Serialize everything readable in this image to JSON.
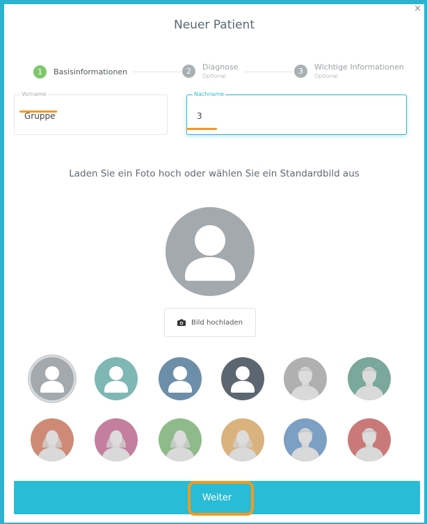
{
  "dialog": {
    "title": "Neuer Patient",
    "close": "×"
  },
  "stepper": [
    {
      "number": "1",
      "label": "Basisinformationen",
      "sub": ""
    },
    {
      "number": "2",
      "label": "Diagnose",
      "sub": "Optional"
    },
    {
      "number": "3",
      "label": "Wichtige Informationen",
      "sub": "Optional"
    }
  ],
  "form": {
    "first_name": {
      "label": "Vorname",
      "value": "Gruppe"
    },
    "last_name": {
      "label": "Nachname",
      "value": "3"
    }
  },
  "photo": {
    "instruction": "Laden Sie ein Foto hoch oder wählen Sie ein Standardbild aus",
    "upload_label": "Bild hochladen"
  },
  "avatar_colors": [
    "#a3a9ad",
    "#7fb7b4",
    "#6d8ea8",
    "#5b6670",
    "#b0b0b0",
    "#7aa89a",
    "#cf8a76",
    "#c47e9e",
    "#8fba8a",
    "#d9b27e",
    "#7c9fc4",
    "#c97a78"
  ],
  "actions": {
    "next_label": "Weiter"
  }
}
